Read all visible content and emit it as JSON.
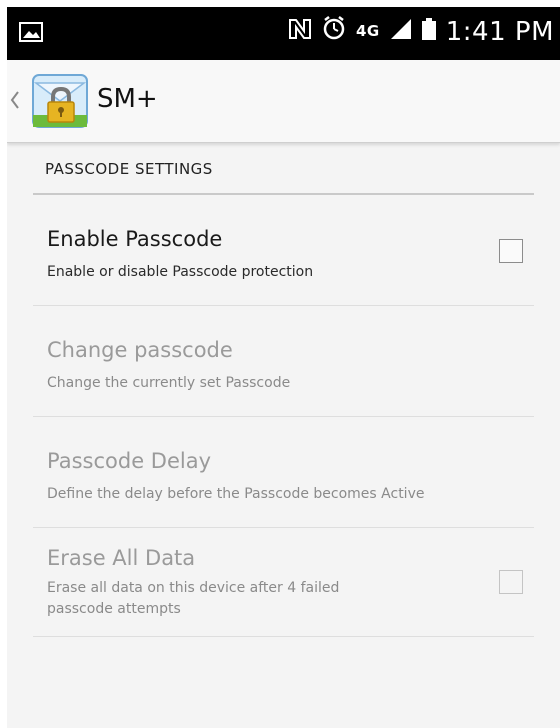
{
  "status_bar": {
    "time": "1:41 PM",
    "network": "4G",
    "icons": [
      "image-notification-icon",
      "nfc-icon",
      "alarm-icon",
      "4g-icon",
      "signal-icon",
      "battery-icon"
    ]
  },
  "action_bar": {
    "title": "SM+",
    "icons": [
      "back-chevron-icon",
      "app-lock-icon"
    ]
  },
  "section": {
    "header": "PASSCODE SETTINGS"
  },
  "preferences": [
    {
      "title": "Enable Passcode",
      "summary": "Enable or disable Passcode protection",
      "enabled": true,
      "has_checkbox": true,
      "checked": false
    },
    {
      "title": "Change passcode",
      "summary": "Change the currently set Passcode",
      "enabled": false,
      "has_checkbox": false
    },
    {
      "title": "Passcode Delay",
      "summary": "Define the delay before the Passcode becomes Active",
      "enabled": false,
      "has_checkbox": false
    },
    {
      "title": "Erase All Data",
      "summary_line1": "Erase all data on this device after 4 failed",
      "summary_line2": "passcode attempts",
      "enabled": false,
      "has_checkbox": true,
      "checked": false
    }
  ]
}
